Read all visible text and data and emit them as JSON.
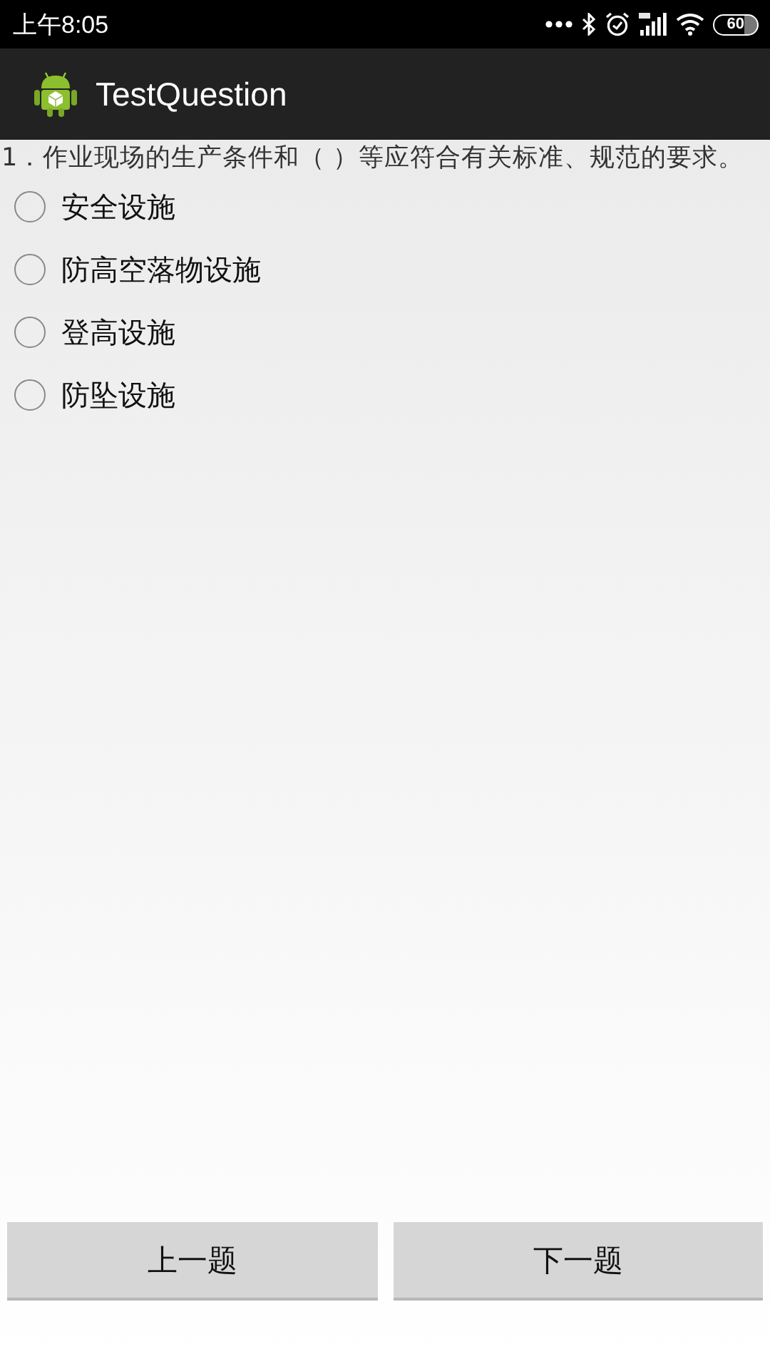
{
  "status_bar": {
    "time": "上午8:05",
    "battery": "60"
  },
  "app_bar": {
    "title": "TestQuestion"
  },
  "question": "1．作业现场的生产条件和（ ）等应符合有关标准、规范的要求。",
  "options": [
    {
      "label": "安全设施",
      "selected": false
    },
    {
      "label": "防高空落物设施",
      "selected": false
    },
    {
      "label": "登高设施",
      "selected": false
    },
    {
      "label": "防坠设施",
      "selected": false
    }
  ],
  "buttons": [
    {
      "label": "上一题"
    },
    {
      "label": "下一题"
    }
  ]
}
